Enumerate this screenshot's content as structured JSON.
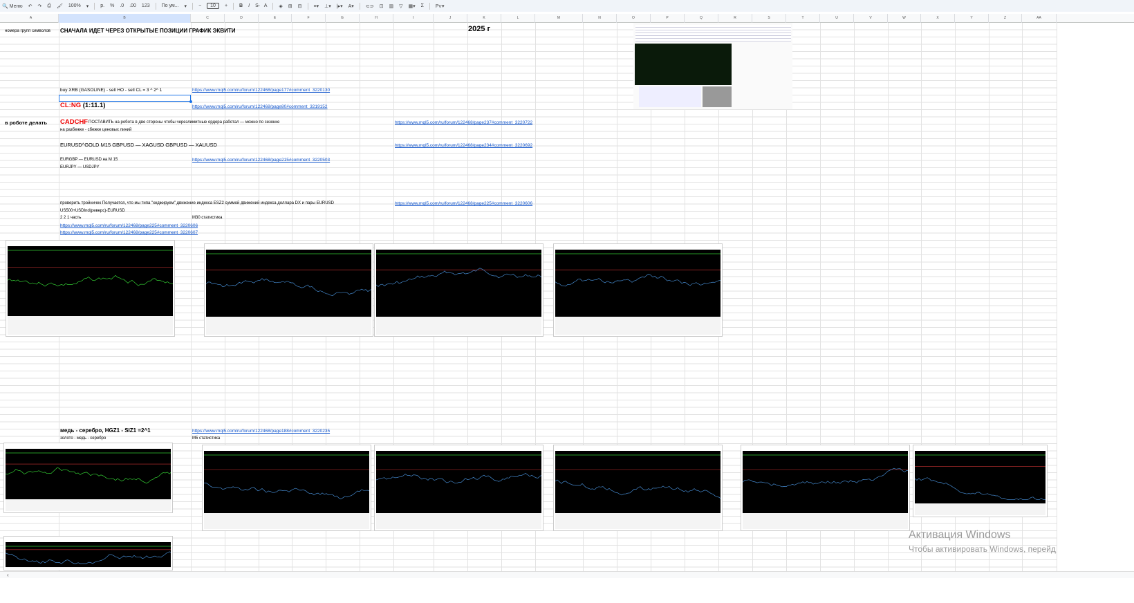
{
  "toolbar": {
    "search": "Меню",
    "zoom": "100%",
    "currency": "р.",
    "percent": "%",
    "dec_less": ".0",
    "dec_more": ".00",
    "format_num": "123",
    "font": "По ум...",
    "font_size": "10",
    "bold": "B",
    "italic": "I"
  },
  "columns": [
    "A",
    "B",
    "C",
    "D",
    "E",
    "F",
    "G",
    "H",
    "I",
    "J",
    "K",
    "L",
    "M",
    "N",
    "O",
    "P",
    "Q",
    "R",
    "S",
    "T",
    "U",
    "V",
    "W",
    "X",
    "Y",
    "Z",
    "AA"
  ],
  "cells": {
    "a_header": "номера групп символов",
    "b_title": "СНАЧАЛА ИДЕТ ЧЕРЕЗ ОТКРЫТЫЕ ПОЗИЦИИ ГРАФИК ЭКВИТИ",
    "year": "2025 г",
    "xrb": "buy XRB (GASOLINE) - sell HO - sell CL = 3 ^ 2^ 1",
    "link1": "https://www.mql5.com/ru/forum/122468/page177#comment_3220130",
    "clng_a": "CL:NG",
    "clng_b": "(1:11.1)",
    "link2": "https://www.mql5.com/ru/forum/122468/page80#comment_3219152",
    "robot": "в роботе делать",
    "cadchf": "CADCHF",
    "cadchf_text": "ПОСТАВИТЬ на робота в две стороны чтобы черезлимитные ордера работал — можно по сезонке",
    "link3": "https://www.mql5.com/ru/forum/122468/page237#comment_3220722",
    "razbeg": "на разбежке -  сбежке ценовых линий",
    "eurusd_gold": "EURUSD^GOLD M15  GBPUSD — XAGUSD    GBPUSD — XAUUSD",
    "link4": "https://www.mql5.com/ru/forum/122468/page234#comment_3220692",
    "eurgbp": "EURGBP — EURUSD  на M 15",
    "link5": "https://www.mql5.com/ru/forum/122468/page215#comment_3220503",
    "eurjpy": "EURJPY — USDJPY",
    "troynik": "проверить тройничек Получается, что мы типа \"хеджируем\" движение индекса ESZ2 суммой движений индекса доллара DX и пары EURUSD",
    "link6": "https://www.mql5.com/ru/forum/122468/page225#comment_3220606",
    "us500": "US500+USDInd(реверс)-EURUSD",
    "chast": "2  2  1  часть",
    "m30": "M30 статистика",
    "link7": "https://www.mql5.com/ru/forum/122468/page225#comment_3220606",
    "link8": "https://www.mql5.com/ru/forum/122468/page225#comment_3220607",
    "med": "медь - серебро, HGZ1 - SIZ1 =2^1",
    "link9": "https://www.mql5.com/ru/forum/122468/page188#comment_3220235",
    "zoloto": "золото - медь - серебро",
    "m5": "M5 статистика"
  },
  "watermark": {
    "title": "Активация Windows",
    "subtitle": "Чтобы активировать Windows, перейд"
  }
}
